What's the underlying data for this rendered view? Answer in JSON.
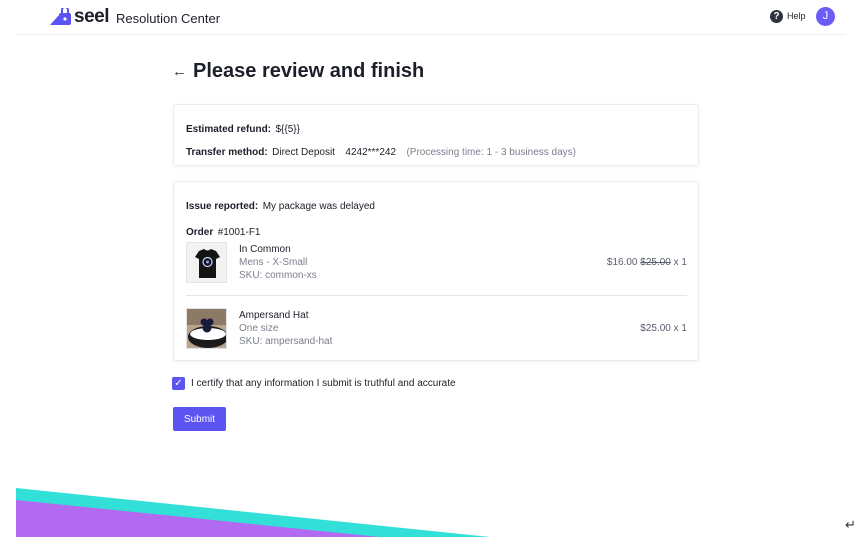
{
  "header": {
    "brand": "seel",
    "app_title": "Resolution Center",
    "help_label": "Help",
    "help_icon": "?",
    "avatar_initial": "J",
    "accent_color": "#5b54f0"
  },
  "page": {
    "title": "Please review and finish"
  },
  "refund": {
    "estimated_label": "Estimated refund:",
    "estimated_value": "${{5}}",
    "transfer_label": "Transfer method:",
    "transfer_value": "Direct Deposit",
    "account": "4242***242",
    "processing": "(Processing time: 1 - 3 business days)"
  },
  "issue": {
    "label": "Issue reported:",
    "value": "My package was delayed"
  },
  "order": {
    "label": "Order",
    "number": "#1001-F1",
    "items": [
      {
        "name": "In Common",
        "variant": "Mens - X-Small",
        "sku": "SKU: common-xs",
        "price": "$16.00",
        "original_price": "$25.00",
        "quantity": "x 1"
      },
      {
        "name": "Ampersand Hat",
        "variant": "One size",
        "sku": "SKU: ampersand-hat",
        "price": "$25.00",
        "original_price": "",
        "quantity": "x 1"
      }
    ]
  },
  "certify": {
    "checked": true,
    "label": "I certify that any information I submit is truthful and accurate"
  },
  "actions": {
    "submit_label": "Submit"
  },
  "colors": {
    "teal": "#33e0d8",
    "purple": "#b26af0"
  }
}
